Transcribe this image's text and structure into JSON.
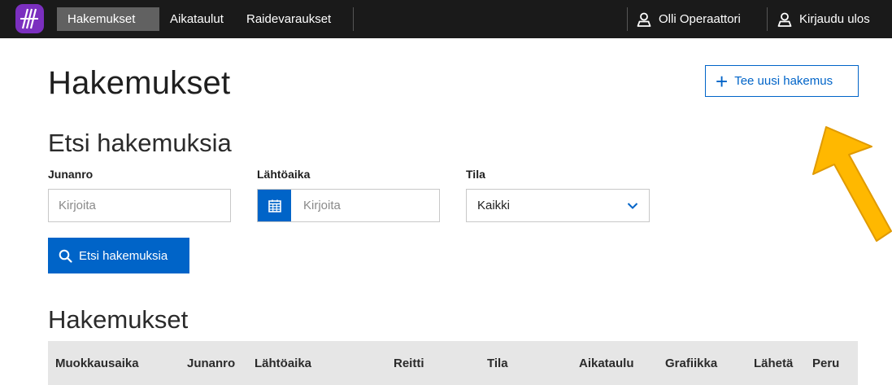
{
  "nav": {
    "tabs": [
      {
        "label": "Hakemukset",
        "active": true
      },
      {
        "label": "Aikataulut",
        "active": false
      },
      {
        "label": "Raidevaraukset",
        "active": false
      }
    ],
    "user_label": "Olli Operaattori",
    "logout_label": "Kirjaudu ulos"
  },
  "page": {
    "title": "Hakemukset",
    "new_button_label": "Tee uusi hakemus"
  },
  "search": {
    "title": "Etsi hakemuksia",
    "train_label": "Junanro",
    "train_placeholder": "Kirjoita",
    "departure_label": "Lähtöaika",
    "departure_placeholder": "Kirjoita",
    "status_label": "Tila",
    "status_value": "Kaikki",
    "button_label": "Etsi hakemuksia"
  },
  "table": {
    "title": "Hakemukset",
    "columns": [
      "Muokkausaika",
      "Junanro",
      "Lähtöaika",
      "Reitti",
      "Tila",
      "Aikataulu",
      "Grafiikka",
      "Lähetä",
      "Peru"
    ]
  },
  "colors": {
    "nav_bg": "#1a1a1a",
    "nav_active": "#616161",
    "primary": "#0064c8",
    "logo": "#7b2fbf",
    "arrow": "#ffb800"
  }
}
